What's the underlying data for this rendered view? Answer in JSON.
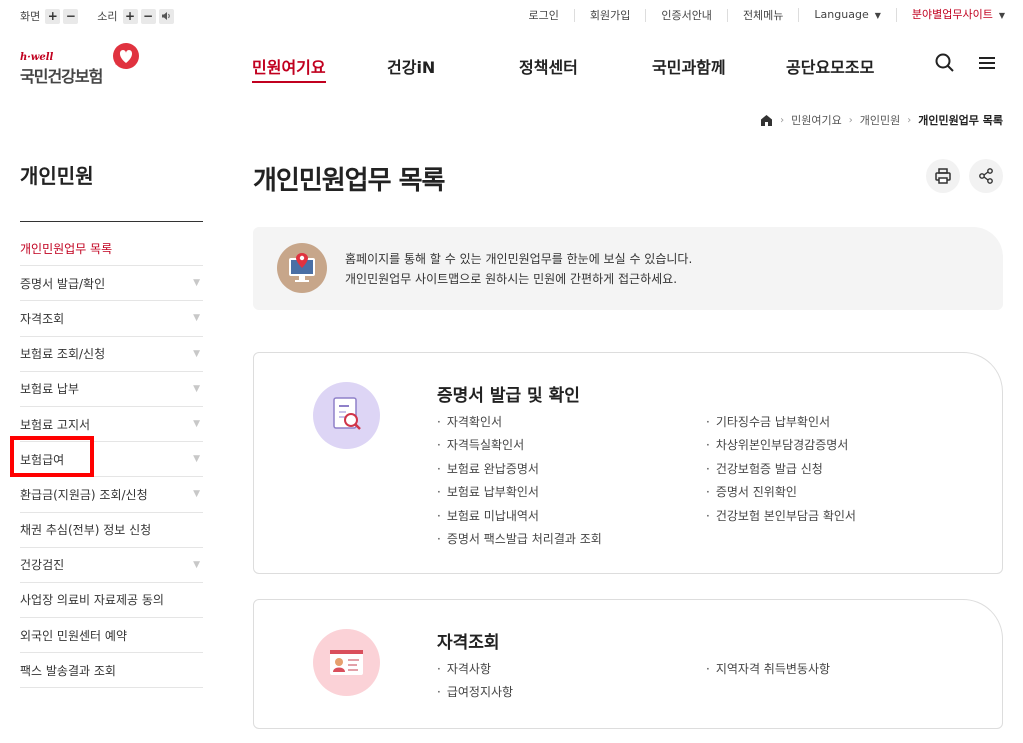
{
  "util": {
    "screen_label": "화면",
    "sound_label": "소리",
    "plus": "+",
    "minus": "−",
    "links": [
      "로그인",
      "회원가입",
      "인증서안내",
      "전체메뉴"
    ],
    "language": "Language",
    "field_site": "분야별업무사이트"
  },
  "logo": {
    "tagline": "h·well",
    "name": "국민건강보험"
  },
  "gnb": [
    "민원여기요",
    "건강iN",
    "정책센터",
    "국민과함께",
    "공단요모조모"
  ],
  "breadcrumb": [
    "민원여기요",
    "개인민원",
    "개인민원업무 목록"
  ],
  "sidebar": {
    "title": "개인민원",
    "items": [
      {
        "label": "개인민원업무 목록",
        "expand": false
      },
      {
        "label": "증명서 발급/확인",
        "expand": true
      },
      {
        "label": "자격조회",
        "expand": true
      },
      {
        "label": "보험료 조회/신청",
        "expand": true
      },
      {
        "label": "보험료 납부",
        "expand": true
      },
      {
        "label": "보험료 고지서",
        "expand": true
      },
      {
        "label": "보험급여",
        "expand": true
      },
      {
        "label": "환급금(지원금) 조회/신청",
        "expand": true
      },
      {
        "label": "채권 추심(전부) 정보 신청",
        "expand": false
      },
      {
        "label": "건강검진",
        "expand": true
      },
      {
        "label": "사업장 의료비 자료제공 동의",
        "expand": false
      },
      {
        "label": "외국인 민원센터 예약",
        "expand": false
      },
      {
        "label": "팩스 발송결과 조회",
        "expand": false
      }
    ]
  },
  "main": {
    "title": "개인민원업무 목록",
    "info_line1": "홈페이지를 통해 할 수 있는 개인민원업무를 한눈에 보실 수 있습니다.",
    "info_line2": "개인민원업무 사이트맵으로 원하시는 민원에 간편하게 접근하세요."
  },
  "cards": [
    {
      "title": "증명서 발급 및 확인",
      "left": [
        "자격확인서",
        "자격득실확인서",
        "보험료 완납증명서",
        "보험료 납부확인서",
        "보험료 미납내역서",
        "증명서 팩스발급 처리결과 조회"
      ],
      "right": [
        "기타징수금 납부확인서",
        "차상위본인부담경감증명서",
        "건강보험증 발급 신청",
        "증명서 진위확인",
        "건강보험 본인부담금 확인서"
      ]
    },
    {
      "title": "자격조회",
      "left": [
        "자격사항",
        "급여정지사항"
      ],
      "right": [
        "지역자격 취득변동사항"
      ]
    }
  ],
  "colors": {
    "brand": "#c1001f",
    "highlight_box": "#ff0000"
  }
}
